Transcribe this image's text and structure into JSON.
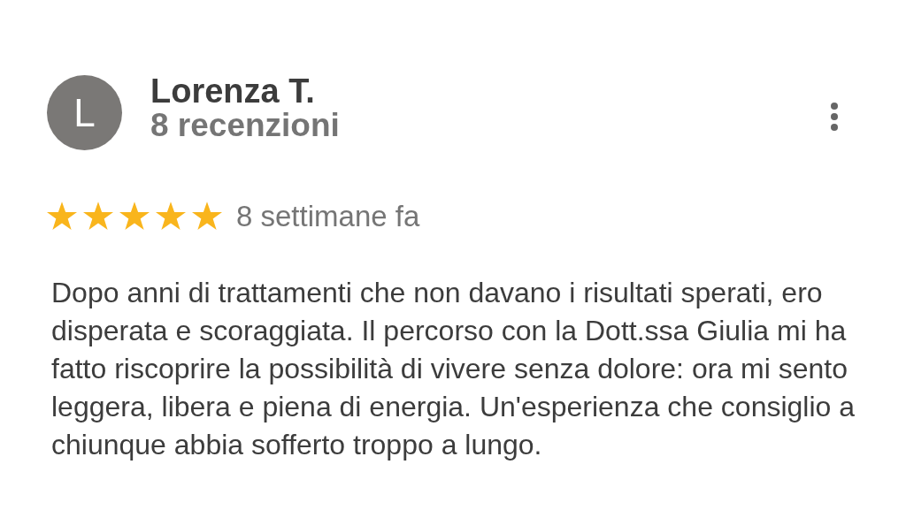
{
  "review": {
    "avatar_letter": "L",
    "author": "Lorenza T.",
    "review_count": "8 recenzioni",
    "stars": 5,
    "time": "8 settimane fa",
    "text": "Dopo anni di trattamenti che non davano i risultati sperati, ero disperata e scoraggiata. Il percorso con la Dott.ssa Giulia mi ha fatto riscoprire la possibilità di vivere senza dolore: ora mi sento leggera, libera e piena di energia. Un'esperienza che consiglio a chiunque abbia sofferto troppo a lungo."
  }
}
